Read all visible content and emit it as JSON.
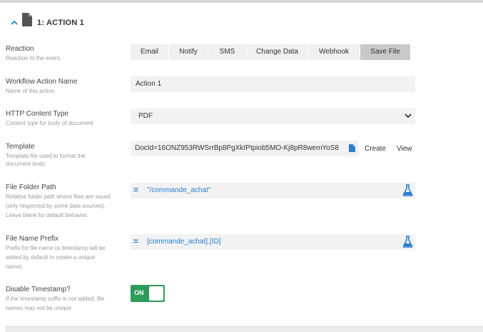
{
  "section": {
    "title": "1: ACTION 1"
  },
  "reaction": {
    "label": "Reaction",
    "hint": "Reaction to the event.",
    "tabs": [
      {
        "label": "Email",
        "active": false
      },
      {
        "label": "Notify",
        "active": false
      },
      {
        "label": "SMS",
        "active": false
      },
      {
        "label": "Change Data",
        "active": false
      },
      {
        "label": "Webhook",
        "active": false
      },
      {
        "label": "Save File",
        "active": true
      }
    ]
  },
  "workflow_action_name": {
    "label": "Workflow Action Name",
    "hint": "Name of this action",
    "value": "Action 1"
  },
  "http_content_type": {
    "label": "HTTP Content Type",
    "hint": "Content type for body of document",
    "value": "PDF"
  },
  "template": {
    "label": "Template",
    "hint_line1": "Template file used to format the",
    "hint_line2": "document body.",
    "value": "DocId=16ONZ953RWSrrBp8PgXkIPtpiob5MO-Kj8pR8wemYoS8",
    "create_label": "Create",
    "view_label": "View"
  },
  "file_folder_path": {
    "label": "File Folder Path",
    "hint_line1": "Relative folder path where files are saved",
    "hint_line2": "(only respected by some data sources).",
    "hint_line3": "Leave blank for default behavior.",
    "eq_symbol": "=",
    "value": "\"/commande_achat\""
  },
  "file_name_prefix": {
    "label": "File Name Prefix",
    "hint_line1": "Prefix for file name (a timestamp will be",
    "hint_line2": "added by default to create a unique",
    "hint_line3": "name)",
    "eq_symbol": "=",
    "value": "[commande_achat].[ID]"
  },
  "disable_timestamp": {
    "label": "Disable Timestamp?",
    "hint_line1": "If the timestamp suffix is not added, file",
    "hint_line2": "names may not be unique",
    "toggle_label": "ON",
    "checked": true
  },
  "colors": {
    "accent_blue": "#2a7fcf",
    "toggle_green": "#2e9a5b",
    "active_tab": "#c9c9c9",
    "field_bg": "#f2f2f2"
  }
}
